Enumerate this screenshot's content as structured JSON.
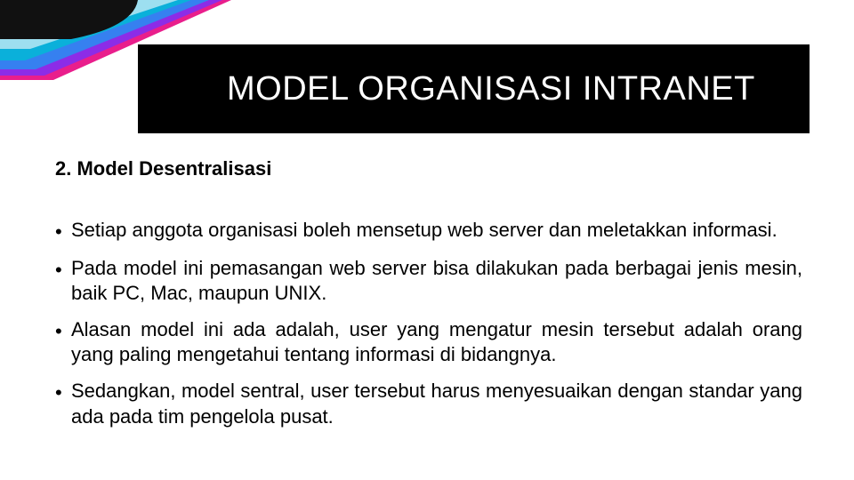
{
  "slide": {
    "title": "MODEL ORGANISASI INTRANET",
    "subtitle": "2. Model Desentralisasi",
    "bullets": [
      "Setiap anggota organisasi boleh mensetup web server dan meletakkan informasi.",
      "Pada model ini pemasangan web server bisa dilakukan pada berbagai jenis mesin, baik PC, Mac, maupun UNIX.",
      "Alasan model ini ada adalah, user yang mengatur mesin tersebut adalah orang yang paling mengetahui tentang informasi di bidangnya.",
      "Sedangkan, model sentral, user tersebut harus menyesuaikan dengan standar yang ada pada tim pengelola pusat."
    ]
  }
}
